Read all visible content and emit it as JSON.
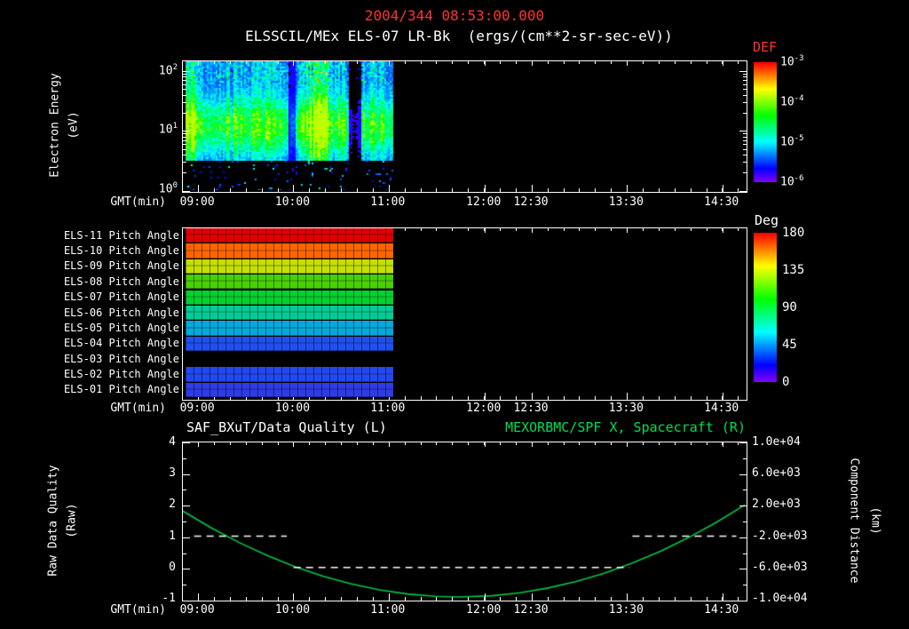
{
  "header": {
    "datetime": "2004/344 08:53:00.000",
    "subtitle": "ELSSCIL/MEx ELS-07 LR-Bk  (ergs/(cm**2-sr-sec-eV))"
  },
  "colors": {
    "title_red": "#ff3232",
    "series_green": "#00dc50",
    "curve_green": "#00c846",
    "axis_white": "#ffffff",
    "background": "#000000"
  },
  "axes": {
    "time_label": "GMT(min)",
    "time_ticks": [
      {
        "label": "09:00",
        "frac": 0.027
      },
      {
        "label": "10:00",
        "frac": 0.196
      },
      {
        "label": "11:00",
        "frac": 0.365
      },
      {
        "label": "12:00",
        "frac": 0.535
      },
      {
        "label": "12:30",
        "frac": 0.619
      },
      {
        "label": "13:30",
        "frac": 0.788
      },
      {
        "label": "14:30",
        "frac": 0.957
      }
    ],
    "minor_tick_step_frac": 0.02817,
    "data_start_frac": 0.004,
    "data_end_frac": 0.375
  },
  "spectrogram": {
    "ylabel": "Electron Energy",
    "ylabel_units": "(eV)",
    "yticks": [
      {
        "exp": "2",
        "frac": 0.073
      },
      {
        "exp": "1",
        "frac": 0.532
      },
      {
        "exp": "0",
        "frac": 0.991
      }
    ],
    "colorbar": {
      "title": "DEF",
      "ticks": [
        {
          "exp": "-3",
          "frac": 0.0
        },
        {
          "exp": "-4",
          "frac": 0.333
        },
        {
          "exp": "-5",
          "frac": 0.667
        },
        {
          "exp": "-6",
          "frac": 1.0
        }
      ]
    }
  },
  "pitch": {
    "rows": [
      {
        "label": "ELS-11 Pitch Angle",
        "deg": 175,
        "color": "#e10000"
      },
      {
        "label": "ELS-10 Pitch Angle",
        "deg": 158,
        "color": "#ff6400"
      },
      {
        "label": "ELS-09 Pitch Angle",
        "deg": 138,
        "color": "#c3e000"
      },
      {
        "label": "ELS-08 Pitch Angle",
        "deg": 120,
        "color": "#46d200"
      },
      {
        "label": "ELS-07 Pitch Angle",
        "deg": 105,
        "color": "#00d22d"
      },
      {
        "label": "ELS-06 Pitch Angle",
        "deg": 92,
        "color": "#00cd96"
      },
      {
        "label": "ELS-05 Pitch Angle",
        "deg": 80,
        "color": "#00aadc"
      },
      {
        "label": "ELS-04 Pitch Angle",
        "deg": 52,
        "color": "#1e50f0"
      },
      {
        "label": "ELS-03 Pitch Angle",
        "deg": null,
        "color": null
      },
      {
        "label": "ELS-02 Pitch Angle",
        "deg": 46,
        "color": "#2347f0"
      },
      {
        "label": "ELS-01 Pitch Angle",
        "deg": 43,
        "color": "#2d3ce8"
      }
    ],
    "colorbar": {
      "title": "Deg",
      "ticks": [
        {
          "label": "180",
          "frac": 0.0
        },
        {
          "label": "135",
          "frac": 0.25
        },
        {
          "label": "90",
          "frac": 0.5
        },
        {
          "label": "45",
          "frac": 0.75
        },
        {
          "label": "0",
          "frac": 1.0
        }
      ]
    }
  },
  "bottom": {
    "left_title": "SAF_BXuT/Data Quality (L)",
    "right_title": "MEXORBMC/SPF X, Spacecraft (R)",
    "left_axis": {
      "label": "Raw Data Quality",
      "units": "(Raw)",
      "ticks": [
        {
          "label": "4",
          "frac": 0.0
        },
        {
          "label": "3",
          "frac": 0.2
        },
        {
          "label": "2",
          "frac": 0.4
        },
        {
          "label": "1",
          "frac": 0.6
        },
        {
          "label": "0",
          "frac": 0.8
        },
        {
          "label": "-1",
          "frac": 1.0
        }
      ]
    },
    "right_axis": {
      "label": "Component Distance",
      "units": "(km)",
      "ticks": [
        {
          "label": "1.0e+04",
          "frac": 0.0
        },
        {
          "label": "6.0e+03",
          "frac": 0.2
        },
        {
          "label": "2.0e+03",
          "frac": 0.4
        },
        {
          "label": "-2.0e+03",
          "frac": 0.6
        },
        {
          "label": "-6.0e+03",
          "frac": 0.8
        },
        {
          "label": "-1.0e+04",
          "frac": 1.0
        }
      ]
    }
  },
  "chart_data": [
    {
      "type": "heatmap",
      "title": "ELSSCIL/MEx ELS-07 LR-Bk",
      "units": "ergs/(cm**2-sr-sec-eV)",
      "xlabel": "GMT(min)",
      "ylabel": "Electron Energy (eV)",
      "x_ticks": [
        "09:00",
        "10:00",
        "11:00",
        "12:00",
        "12:30",
        "13:30",
        "14:30"
      ],
      "y_scale": "log",
      "y_range_eV": [
        1,
        140
      ],
      "colorbar": {
        "label": "DEF",
        "scale": "log",
        "range_low": 1e-06,
        "range_high": 0.001
      },
      "summary": "Electron flux measured from ~08:53 to ~11:05; intense 4-40 eV band near 1e-4, weaker 40-150 eV flux near 1e-5, sparse purple speckle below 3 eV; no data after ~11:05."
    },
    {
      "type": "heatmap",
      "title": "ELS Pitch Angles",
      "rows": [
        "ELS-11",
        "ELS-10",
        "ELS-09",
        "ELS-08",
        "ELS-07",
        "ELS-06",
        "ELS-05",
        "ELS-04",
        "ELS-03",
        "ELS-02",
        "ELS-01"
      ],
      "pitch_angle_deg": [
        175,
        158,
        138,
        120,
        105,
        92,
        80,
        52,
        null,
        46,
        43
      ],
      "colorbar": {
        "label": "Deg",
        "range": [
          0,
          180
        ]
      },
      "coverage": "constant values from ~08:53 to ~11:05; ELS-03 has no data"
    },
    {
      "type": "line",
      "xlabel": "GMT(min)",
      "left_ylim": [
        -1,
        4
      ],
      "right_ylim": [
        -10000,
        10000
      ],
      "series": [
        {
          "name": "SAF_BXuT/Data Quality (L)",
          "axis": "left",
          "style": "dashed",
          "color": "#ffffff",
          "segments": [
            {
              "t0_frac": 0.02,
              "t1_frac": 0.185,
              "value": 1
            },
            {
              "t0_frac": 0.197,
              "t1_frac": 0.795,
              "value": 0
            },
            {
              "t0_frac": 0.8,
              "t1_frac": 0.985,
              "value": 1
            }
          ]
        },
        {
          "name": "MEXORBMC/SPF X, Spacecraft (R)",
          "axis": "right",
          "style": "solid",
          "color": "#00c846",
          "points_frac_km": [
            [
              0.0,
              1215
            ],
            [
              0.05,
              -907
            ],
            [
              0.1,
              -2801
            ],
            [
              0.15,
              -4468
            ],
            [
              0.2,
              -5907
            ],
            [
              0.25,
              -7119
            ],
            [
              0.3,
              -8104
            ],
            [
              0.35,
              -8860
            ],
            [
              0.4,
              -9390
            ],
            [
              0.45,
              -9692
            ],
            [
              0.49,
              -9770
            ],
            [
              0.55,
              -9613
            ],
            [
              0.6,
              -9232
            ],
            [
              0.65,
              -8624
            ],
            [
              0.7,
              -7788
            ],
            [
              0.75,
              -6724
            ],
            [
              0.8,
              -5433
            ],
            [
              0.85,
              -3914
            ],
            [
              0.9,
              -2168
            ],
            [
              0.95,
              -194
            ],
            [
              1.0,
              2007
            ]
          ]
        }
      ]
    }
  ]
}
